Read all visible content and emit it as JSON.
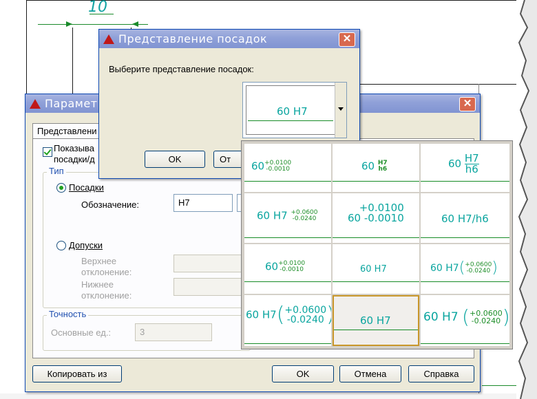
{
  "drawing": {
    "dimension": "10"
  },
  "parameters_dialog": {
    "title": "Параметр",
    "tab_label": "Представлени",
    "show_fits_label_1": "Показыва",
    "show_fits_label_2": "посадки/д",
    "type_group": "Тип",
    "radio_fits": "Посадки",
    "designation_label": "Обозначение:",
    "designation_value": "H7",
    "radio_tolerances": "Допуски",
    "upper_label_1": "Верхнее",
    "upper_label_2": "отклонение:",
    "lower_label_1": "Нижнее",
    "lower_label_2": "отклонение:",
    "precision_group": "Точность",
    "main_units_label": "Основные ед.:",
    "main_units_value": "3",
    "copy_from": "Копировать из",
    "ok": "OK",
    "cancel": "Отмена",
    "help": "Справка"
  },
  "fits_dialog": {
    "title": "Представление посадок",
    "prompt": "Выберите представление посадок:",
    "preview": "60 H7",
    "ok": "OK",
    "cancel_partial": "От"
  },
  "options": [
    {
      "base": "60",
      "upper": "+0.0100",
      "lower": "-0.0010"
    },
    {
      "base": "60",
      "upper": "H7",
      "lower": "h6"
    },
    {
      "base": "60",
      "upper": "H7",
      "lower": "h6"
    },
    {
      "base": "60 H7",
      "upper": "+0.0600",
      "lower": "-0.0240"
    },
    {
      "upper": "+0.0100",
      "lower": "60 -0.0010"
    },
    {
      "text": "60 H7/h6"
    },
    {
      "base": "60",
      "upper": "+0.0100",
      "lower": "-0.0010"
    },
    {
      "text": "60 H7"
    },
    {
      "base": "60 H7",
      "upper": "+0.0600",
      "lower": "-0.0240"
    },
    {
      "base": "60 H7",
      "upper": "+0.0600",
      "lower": "-0.0240"
    },
    {
      "text": "60 H7"
    },
    {
      "base": "60 H7",
      "upper": "+0.0600",
      "lower": "-0.0240"
    }
  ],
  "colors": {
    "accent_text": "#0aa59f",
    "green_line": "#168b26",
    "selection_border": "#c8962a",
    "titlebar": "#8fa0d8"
  }
}
